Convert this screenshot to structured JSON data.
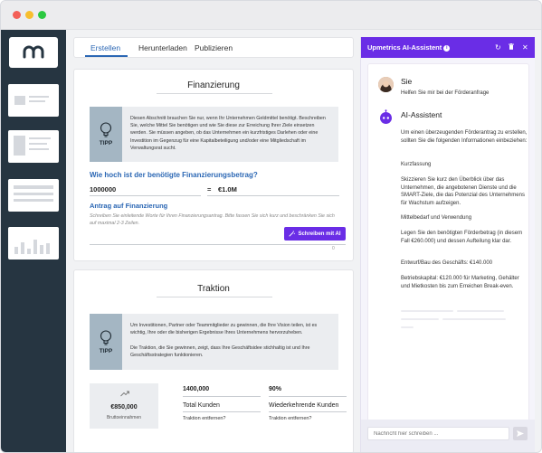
{
  "tabs": [
    {
      "label": "Erstellen",
      "active": true
    },
    {
      "label": "Herunterladen",
      "active": false
    },
    {
      "label": "Publizieren",
      "active": false
    }
  ],
  "financing": {
    "title": "Finanzierung",
    "tip_label": "TIPP",
    "tip_text": "Diesen Abschnitt brauchen Sie nur, wenn Ihr Unternehmen Geldmittel benötigt. Beschreiben Sie, welche Mittel Sie benötigen und wie Sie diese zur Erreichung Ihrer Ziele einsetzen werden. Sie müssen angeben, ob das Unternehmen ein kurzfristiges Darlehen oder eine Investition im Gegenzug für eine Kapitalbeteiligung und/oder eine Mitgliedschaft im Verwaltungsrat sucht.",
    "question": "Wie hoch ist der benötigte Finanzierungsbetrag?",
    "amount_input": "1000000",
    "equals": "=",
    "amount_display": "€1.0M",
    "request_label": "Antrag auf Finanzierung",
    "request_placeholder": "Schreiben Sie einleitende Worte für Ihren Finanzierungsantrag. Bitte fassen Sie sich kurz und beschränken Sie sich auf maximal 2-3 Zeilen.",
    "ai_button": "Schreiben mit AI",
    "char_count": "0"
  },
  "traction": {
    "title": "Traktion",
    "tip_label": "TIPP",
    "tip_text_1": "Um Investitionen, Partner oder Teammitglieder zu gewinnen, die Ihre Vision teilen, ist es wichtig, Ihre oder die bisherigen Ergebnisse Ihres Unternehmens hervorzuheben.",
    "tip_text_2": "Die Traktion, die Sie gewinnen, zeigt, dass Ihre Geschäftsidee stichhaltig ist und Ihre Geschäftsstrategien funktionieren.",
    "stat_value": "€850,000",
    "stat_label": "Bruttoeinnahmen",
    "metrics": [
      {
        "value": "1400,000",
        "label": "Total Kunden",
        "link": "Traktion entfernen?"
      },
      {
        "value": "90%",
        "label": "Wiederkehrende Kunden",
        "link": "Traktion entfernen?"
      }
    ]
  },
  "assistant": {
    "title": "Upmetrics AI-Assistent",
    "user_name": "Sie",
    "user_message": "Helfen Sie mir bei der Förderanfrage",
    "bot_name": "AI-Assistent",
    "bot_paragraphs": [
      "Um einen überzeugenden Förderantrag zu erstellen, sollten Sie die folgenden Informationen einbeziehen:",
      "Kurzfassung",
      "Skizzieren Sie kurz den Überblick über das Unternehmen, die angebotenen Dienste und die SMART-Ziele, die das Potenzial des Unternehmens für Wachstum aufzeigen.",
      "Mittelbedarf und Verwendung",
      "Legen Sie den benötigten Förderbetrag (in diesem Fall €260.000) und dessen Aufteilung klar dar.",
      "Entwurf/Bau des Geschäfts: €140.000",
      "Betriebskapital: €120.000 für Marketing, Gehälter und Mietkosten bis zum Erreichen Break-even."
    ],
    "input_placeholder": "Nachricht hier schreiben ..."
  },
  "colors": {
    "accent": "#6a2de6",
    "link_blue": "#2b67b4",
    "sidebar": "#263541",
    "tip_icon_bg": "#a4b6c3"
  }
}
